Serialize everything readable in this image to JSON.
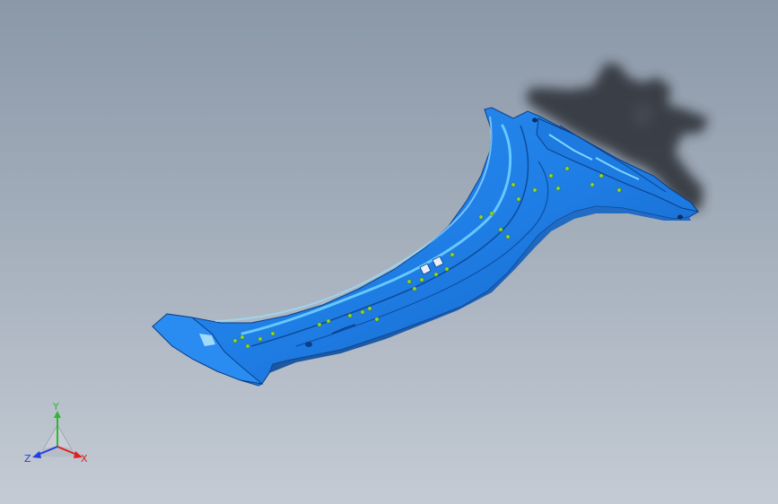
{
  "viewport": {
    "background_top": "#8b98a8",
    "background_bottom": "#c4cbd4"
  },
  "model": {
    "part_color": "#1f7fe6",
    "part_edge_color": "#0a3f8a",
    "highlight_color": "#6fd0ff",
    "weld_point_color": "#8ed62a",
    "shadow_color": "#2a2e36",
    "weld_point_count": 30
  },
  "triad": {
    "x_label": "X",
    "y_label": "Y",
    "z_label": "Z",
    "x_color": "#e02020",
    "y_color": "#2fb82f",
    "z_color": "#2040e0"
  }
}
